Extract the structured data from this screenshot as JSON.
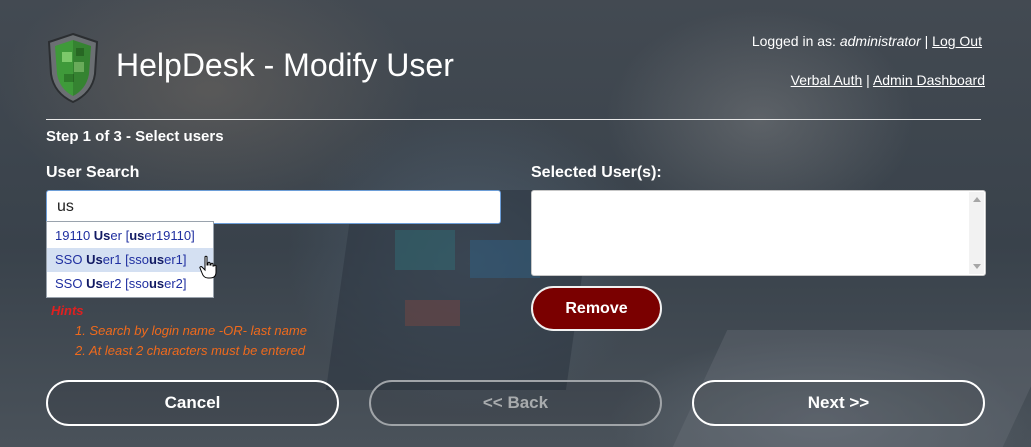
{
  "header": {
    "title": "HelpDesk - Modify User",
    "logged_in_prefix": "Logged in as:",
    "username": "administrator",
    "separator": "|",
    "logout_label": "Log Out",
    "verbal_auth_label": "Verbal Auth",
    "admin_dashboard_label": "Admin Dashboard"
  },
  "step": {
    "label": "Step 1 of 3 - Select users"
  },
  "search": {
    "label": "User Search",
    "value": "us",
    "suggestions": [
      {
        "parts": [
          "19110 ",
          "Us",
          "er [",
          "us",
          "er19110]"
        ],
        "active": false
      },
      {
        "parts": [
          "SSO ",
          "Us",
          "er1 [sso",
          "us",
          "er1]"
        ],
        "active": true
      },
      {
        "parts": [
          "SSO ",
          "Us",
          "er2 [sso",
          "us",
          "er2]"
        ],
        "active": false
      }
    ]
  },
  "hints": {
    "title": "Hints",
    "items": [
      "1. Search by login name -OR- last name",
      "2. At least 2 characters must be entered"
    ]
  },
  "selected": {
    "label": "Selected User(s):",
    "remove_label": "Remove"
  },
  "footer": {
    "cancel_label": "Cancel",
    "back_label": "<< Back",
    "next_label": "Next >>"
  },
  "colors": {
    "remove_button": "#7a0000",
    "hint_title": "#e02020",
    "hint_text": "#f06a1c",
    "suggestion_text": "#1f2fa0",
    "suggestion_active_bg": "#d4e0f2"
  },
  "icons": {
    "logo": "shield-logo-icon",
    "pointer": "hand-pointer-icon"
  }
}
